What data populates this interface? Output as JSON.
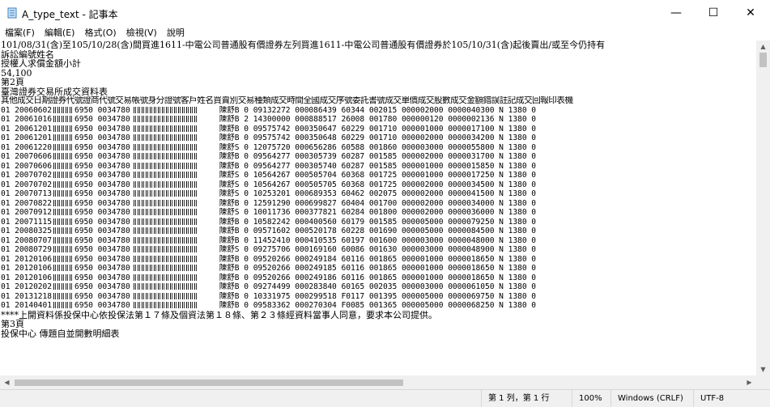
{
  "window": {
    "title": "A_type_text - 記事本",
    "minimize": "—",
    "maximize": "☐",
    "close": "✕"
  },
  "menu": [
    "檔案(F)",
    "編輯(E)",
    "格式(O)",
    "檢視(V)",
    "說明"
  ],
  "content": {
    "intro": [
      "101/08/31(含)至105/10/28(含)間買進1611-中電公司普通股有價證券左列買進1611-中電公司普通股有價證券於105/10/31(含)起後賣出/或至今仍持有",
      "訴訟編號姓名",
      "授權人求償金額小計",
      "54,100",
      "第2頁",
      "臺灣證券交易所成交資料表",
      "其他成交日期證券代號證商代號交易帳號身分證號客戶姓名買賣別交易種類成交時間全國成交序號委託書號成交單價成交股數成交金額錯誤註記成交回報印表機"
    ],
    "rows": [
      {
        "pre": "01 20060602",
        "a": "6950 0034780",
        "b": "陳舒B 0 09132272 000086439 60344 002015 000002000 0000040300 N 1380 0"
      },
      {
        "pre": "01 20061016",
        "a": "6950 0034780",
        "b": "陳舒B 2 14300000 000888517 26008 001780 000000120 0000002136 N 1380 0"
      },
      {
        "pre": "01 20061201",
        "a": "6950 0034780",
        "b": "陳舒B 0 09575742 000350647 60229 001710 000001000 0000017100 N 1380 0"
      },
      {
        "pre": "01 20061201",
        "a": "6950 0034780",
        "b": "陳舒B 0 09575742 000350648 60229 001710 000002000 0000034200 N 1380 0"
      },
      {
        "pre": "01 20061220",
        "a": "6950 0034780",
        "b": "陳舒S 0 12075720 000656286 60588 001860 000003000 0000055800 N 1380 0"
      },
      {
        "pre": "01 20070606",
        "a": "6950 0034780",
        "b": "陳舒B 0 09564277 000305739 60287 001585 000002000 0000031700 N 1380 0"
      },
      {
        "pre": "01 20070606",
        "a": "6950 0034780",
        "b": "陳舒B 0 09564277 000305740 60287 001585 000001000 0000015850 N 1380 0"
      },
      {
        "pre": "01 20070702",
        "a": "6950 0034780",
        "b": "陳舒S 0 10564267 000505704 60368 001725 000001000 0000017250 N 1380 0"
      },
      {
        "pre": "01 20070702",
        "a": "6950 0034780",
        "b": "陳舒S 0 10564267 000505705 60368 001725 000002000 0000034500 N 1380 0"
      },
      {
        "pre": "01 20070713",
        "a": "6950 0034780",
        "b": "陳舒S 0 10253201 000689353 60462 002075 000002000 0000041500 N 1380 0"
      },
      {
        "pre": "01 20070822",
        "a": "6950 0034780",
        "b": "陳舒B 0 12591290 000699827 60404 001700 000002000 0000034000 N 1380 0"
      },
      {
        "pre": "01 20070912",
        "a": "6950 0034780",
        "b": "陳舒S 0 10011736 000377821 60284 001800 000002000 0000036000 N 1380 0"
      },
      {
        "pre": "01 20071115",
        "a": "6950 0034780",
        "b": "陳舒B 0 10582242 000400560 60179 001585 000005000 0000079250 N 1380 0"
      },
      {
        "pre": "01 20080325",
        "a": "6950 0034780",
        "b": "陳舒B 0 09571602 000520178 60228 001690 000005000 0000084500 N 1380 0"
      },
      {
        "pre": "01 20080707",
        "a": "6950 0034780",
        "b": "陳舒B 0 11452410 000410535 60197 001600 000003000 0000048000 N 1380 0"
      },
      {
        "pre": "01 20080729",
        "a": "6950 0034780",
        "b": "陳舒S 0 09275706 000169160 60086 001630 000003000 0000048900 N 1380 0"
      },
      {
        "pre": "01 20120106",
        "a": "6950 0034780",
        "b": "陳舒B 0 09520266 000249184 60116 001865 000001000 0000018650 N 1380 0"
      },
      {
        "pre": "01 20120106",
        "a": "6950 0034780",
        "b": "陳舒B 0 09520266 000249185 60116 001865 000001000 0000018650 N 1380 0"
      },
      {
        "pre": "01 20120106",
        "a": "6950 0034780",
        "b": "陳舒B 0 09520266 000249186 60116 001865 000001000 0000018650 N 1380 0"
      },
      {
        "pre": "01 20120202",
        "a": "6950 0034780",
        "b": "陳舒B 0 09274499 000283840 60165 002035 000003000 0000061050 N 1380 0"
      },
      {
        "pre": "01 20131218",
        "a": "6950 0034780",
        "b": "陳舒B 0 10331975 000299518 F0117 001395 000005000 0000069750 N 1380 0"
      },
      {
        "pre": "01 20140401",
        "a": "6950 0034780",
        "b": "陳舒B 0 09583362 000270304 F0085 001365 000005000 0000068250 N 1380 0"
      }
    ],
    "outro": [
      "****上開資料係投保中心依投保法第１７條及個資法第１８條、第２３條經資料當事人同意，要求本公司提供。",
      "第3頁",
      "投保中心 傳題自並開數明細表"
    ]
  },
  "status": {
    "position": "第 1 列，第 1 行",
    "zoom": "100%",
    "line_ending": "Windows (CRLF)",
    "encoding": "UTF-8"
  }
}
